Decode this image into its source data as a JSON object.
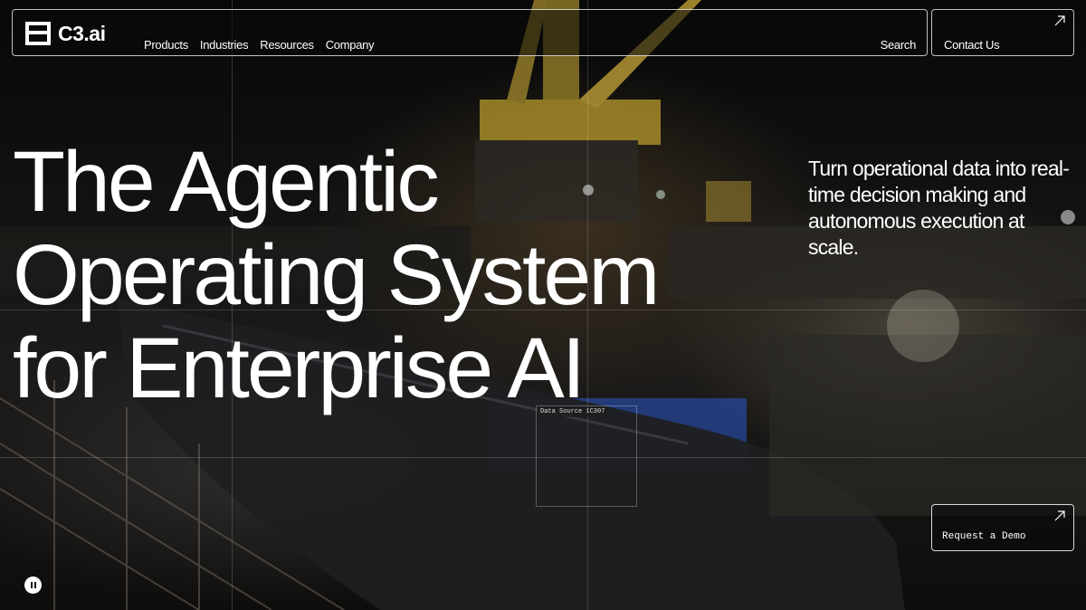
{
  "header": {
    "logo_text": "C3.ai",
    "logo_icon": "c3-logo-mark",
    "nav_items": [
      "Products",
      "Industries",
      "Resources",
      "Company"
    ],
    "search_label": "Search",
    "contact_label": "Contact Us",
    "arrow_icon": "arrow-up-right-icon"
  },
  "hero": {
    "headline_lines": [
      "The Agentic",
      "Operating System",
      "for Enterprise AI"
    ],
    "subhead": "Turn operational data into real-time decision making and autonomous execution at scale.",
    "data_source_tag": "Data Source 1C307",
    "cta_label": "Request a Demo",
    "pause_icon": "pause-icon"
  },
  "colors": {
    "text": "#ffffff",
    "accent_blue": "#2a57c9",
    "crane_yellow": "#d6b132",
    "background": "#0b0b0b"
  }
}
